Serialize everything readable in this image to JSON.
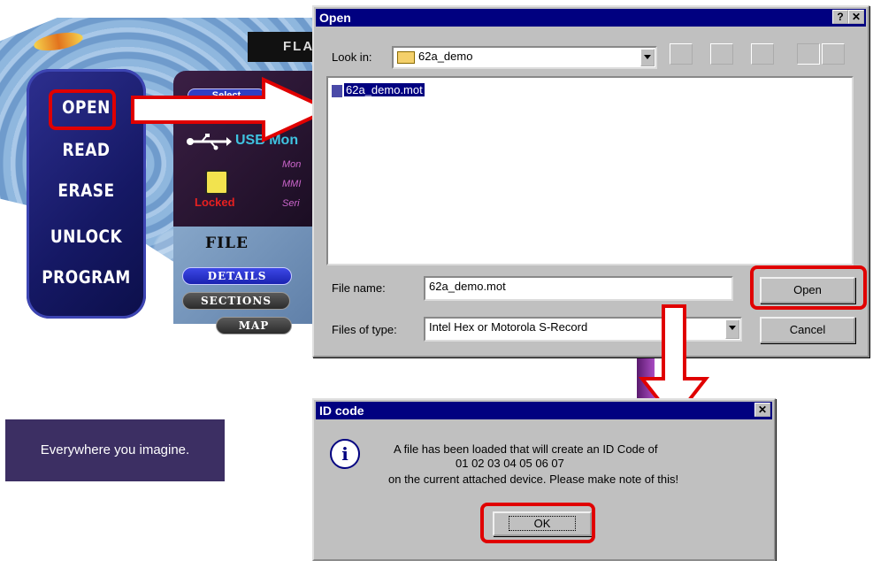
{
  "app": {
    "title_partial": "FLA",
    "nav": [
      "OPEN",
      "READ",
      "ERASE",
      "UNLOCK",
      "PROGRAM"
    ],
    "select_label": "Select",
    "usb_text": "USB Mon",
    "lock_label": "Locked",
    "info_lines": [
      "Mon",
      "MMI",
      "Seri"
    ],
    "file_title": "FILE",
    "file_tabs": [
      "DETAILS",
      "SECTIONS",
      "MAP"
    ],
    "banner_text": "Everywhere you imagine."
  },
  "open_dialog": {
    "title": "Open",
    "help_btn": "?",
    "close_btn": "✕",
    "look_in_label": "Look in:",
    "look_in_value": "62a_demo",
    "files": [
      "62a_demo.mot"
    ],
    "file_name_label": "File name:",
    "file_name_value": "62a_demo.mot",
    "files_of_type_label": "Files of type:",
    "files_of_type_value": "Intel Hex or Motorola S-Record",
    "open_btn": "Open",
    "cancel_btn": "Cancel"
  },
  "id_dialog": {
    "title": "ID code",
    "close_btn": "✕",
    "message_line1": "A file has been loaded that will create an ID Code of",
    "message_line2": "01 02 03 04 05 06 07",
    "message_line3": "on the current attached device. Please make note of this!",
    "ok_btn": "OK",
    "info_icon": "i"
  },
  "colors": {
    "highlight": "#e00000",
    "titlebar": "#000080",
    "win_gray": "#c0c0c0"
  }
}
